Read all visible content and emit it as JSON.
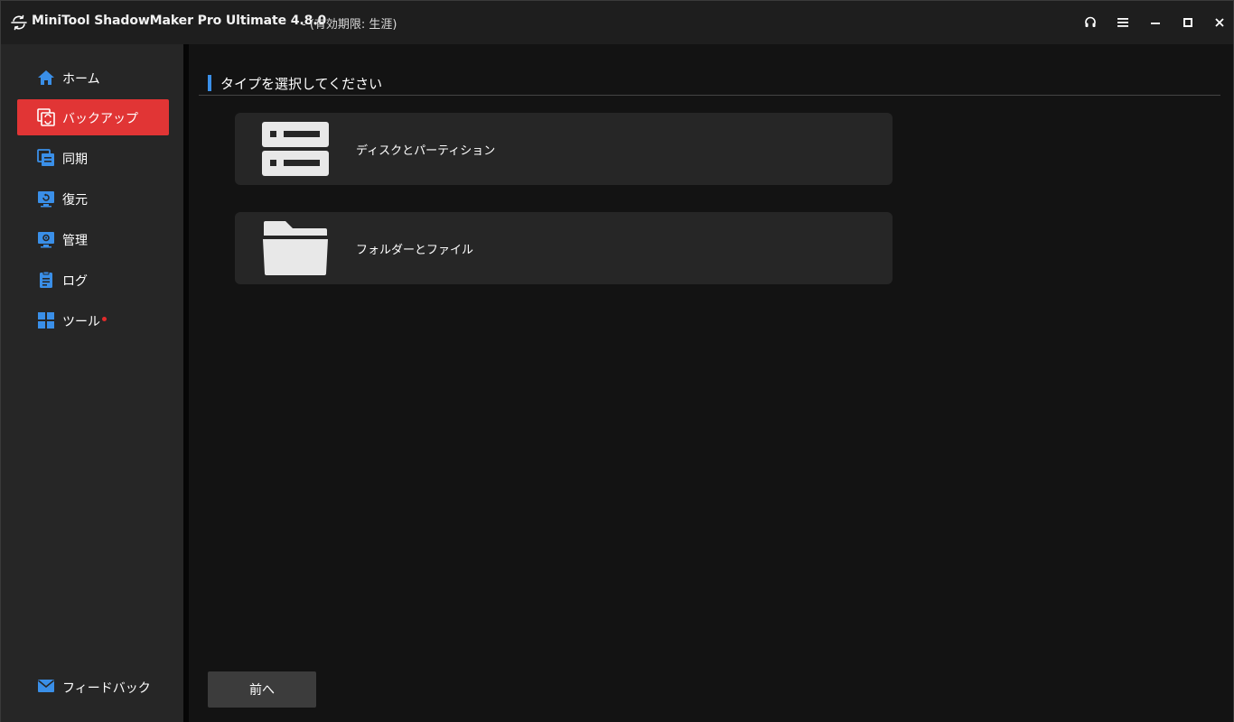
{
  "window": {
    "title": "MiniTool ShadowMaker Pro Ultimate 4.8.0",
    "license": "- (有効期限: 生涯)",
    "controls": [
      {
        "name": "support-icon"
      },
      {
        "name": "menu-icon"
      },
      {
        "name": "minimize-icon"
      },
      {
        "name": "maximize-icon"
      },
      {
        "name": "close-icon"
      }
    ]
  },
  "sidebar": {
    "items": [
      {
        "label": "ホーム",
        "icon": "home-icon",
        "active": false
      },
      {
        "label": "バックアップ",
        "icon": "backup-icon",
        "active": true
      },
      {
        "label": "同期",
        "icon": "sync-icon",
        "active": false
      },
      {
        "label": "復元",
        "icon": "restore-icon",
        "active": false
      },
      {
        "label": "管理",
        "icon": "manage-icon",
        "active": false
      },
      {
        "label": "ログ",
        "icon": "log-icon",
        "active": false
      },
      {
        "label": "ツール",
        "icon": "tools-icon",
        "active": false,
        "notification_dot": true
      }
    ],
    "feedback": {
      "label": "フィードバック",
      "icon": "mail-icon"
    }
  },
  "main": {
    "section_title": "タイプを選択してください",
    "options": [
      {
        "label": "ディスクとパーティション",
        "icon": "disk-partition-icon"
      },
      {
        "label": "フォルダーとファイル",
        "icon": "folder-icon"
      }
    ],
    "back_label": "前へ"
  },
  "colors": {
    "accent_red": "#e13535",
    "accent_blue": "#3a8fe8",
    "sidebar_bg": "#262626",
    "main_bg": "#131313",
    "card_bg": "#262626",
    "notification_dot": "#e22b2b"
  }
}
